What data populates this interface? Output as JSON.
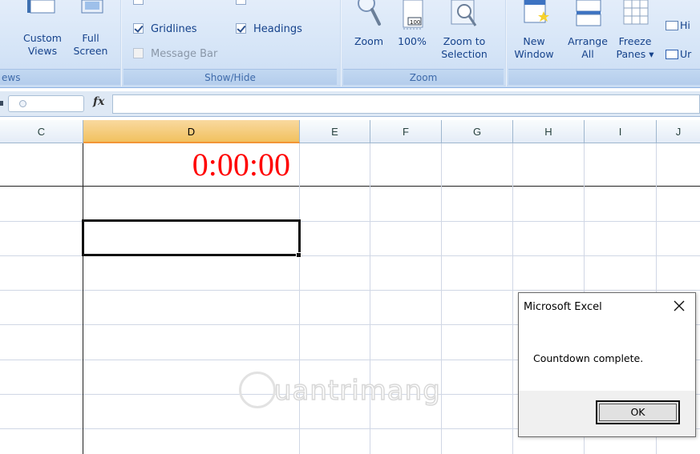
{
  "ribbon": {
    "groups": {
      "views_partial": "ews",
      "show_hide": "Show/Hide",
      "zoom": "Zoom"
    },
    "buttons": {
      "custom_views": [
        "Custom",
        "Views"
      ],
      "full_screen": [
        "Full",
        "Screen"
      ],
      "zoom": "Zoom",
      "zoom_100": "100%",
      "zoom_to_selection": [
        "Zoom to",
        "Selection"
      ],
      "new_window": [
        "New",
        "Window"
      ],
      "arrange_all": [
        "Arrange",
        "All"
      ],
      "freeze_panes": [
        "Freeze",
        "Panes ▾"
      ],
      "hide_partial": "Hi",
      "unhide_partial": "Ur"
    },
    "checkboxes": {
      "gridlines": {
        "label": "Gridlines",
        "checked": true
      },
      "headings": {
        "label": "Headings",
        "checked": true
      },
      "message_bar": {
        "label": "Message Bar",
        "checked": false,
        "disabled": true
      }
    }
  },
  "formula_bar": {
    "fx": "fx",
    "value": ""
  },
  "sheet": {
    "columns": [
      "C",
      "D",
      "E",
      "F",
      "G",
      "H",
      "I",
      "J"
    ],
    "selected_column": "D",
    "cells": {
      "D1": "0:00:00"
    },
    "cell_color": "#ff0000"
  },
  "watermark": {
    "text": "uantrimang"
  },
  "dialog": {
    "title": "Microsoft Excel",
    "message": "Countdown complete.",
    "ok_label": "OK"
  }
}
